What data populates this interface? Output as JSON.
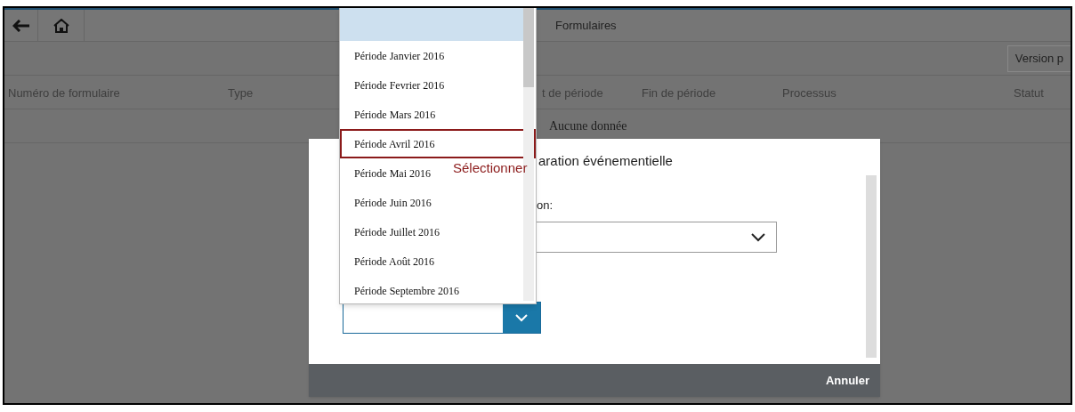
{
  "header": {
    "title": "Formulaires"
  },
  "toolbar": {
    "button": "Version p"
  },
  "table": {
    "columns": [
      "Numéro de formulaire",
      "Type",
      "t de période",
      "Fin de période",
      "Processus",
      "Statut"
    ],
    "empty_text": "Aucune donnée"
  },
  "dialog": {
    "title": "aration événementielle",
    "field_label": "on:",
    "button": "Annuler"
  },
  "dropdown": {
    "options": [
      {
        "label": "Période Janvier 2016",
        "selected": false
      },
      {
        "label": "Période Fevrier 2016",
        "selected": false
      },
      {
        "label": "Période Mars 2016",
        "selected": false
      },
      {
        "label": "Période Avril 2016",
        "selected": true
      },
      {
        "label": "Période Mai 2016",
        "selected": false
      },
      {
        "label": "Période Juin 2016",
        "selected": false
      },
      {
        "label": "Période Juillet 2016",
        "selected": false
      },
      {
        "label": "Période Août 2016",
        "selected": false
      },
      {
        "label": "Période Septembre 2016",
        "selected": false
      }
    ]
  },
  "annotation": "Sélectionner"
}
